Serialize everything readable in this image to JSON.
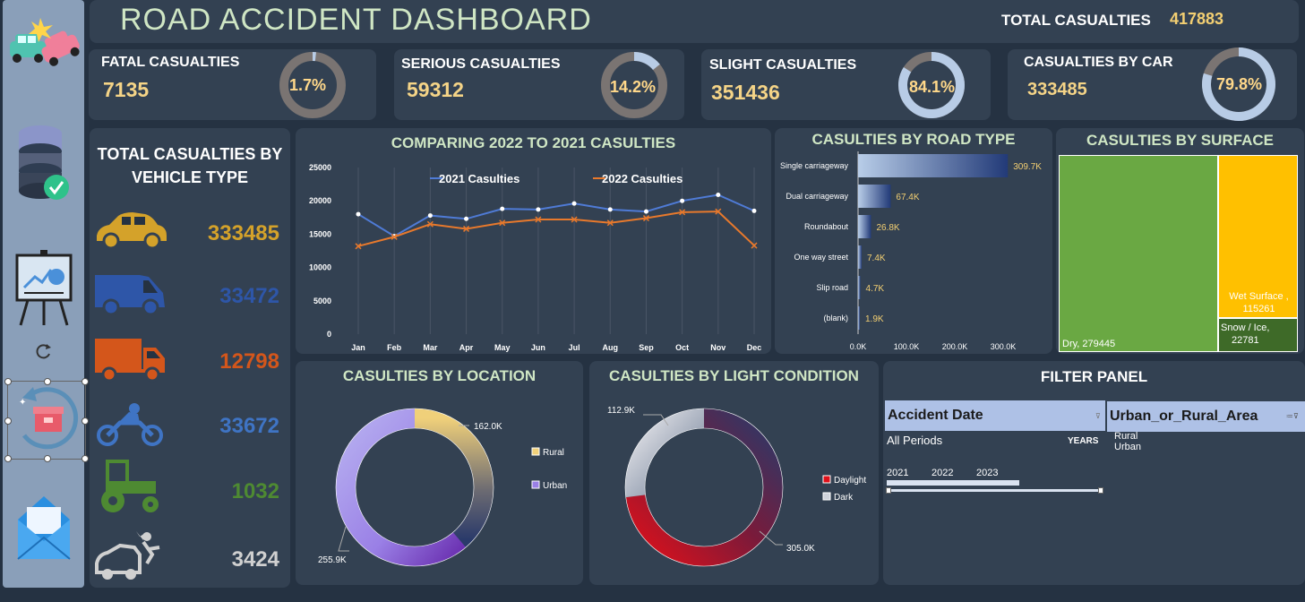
{
  "header": {
    "title": "ROAD ACCIDENT DASHBOARD",
    "total_label": "TOTAL CASUALTIES",
    "total_value": "417883"
  },
  "kpis": [
    {
      "label": "FATAL CASUALTIES",
      "value": "7135",
      "pct_label": "1.7%",
      "pct": 1.7
    },
    {
      "label": "SERIOUS CASUALTIES",
      "value": "59312",
      "pct_label": "14.2%",
      "pct": 14.2
    },
    {
      "label": "SLIGHT CASUALTIES",
      "value": "351436",
      "pct_label": "84.1%",
      "pct": 84.1
    },
    {
      "label": "CASUALTIES BY CAR",
      "value": "333485",
      "pct_label": "79.8%",
      "pct": 79.8
    }
  ],
  "vehicles": {
    "title_line1": "TOTAL CASUALTIES BY",
    "title_line2": "VEHICLE TYPE",
    "items": [
      {
        "icon": "car-icon",
        "value": "333485",
        "color": "#d4a22a"
      },
      {
        "icon": "van-icon",
        "value": "33472",
        "color": "#2e56a8"
      },
      {
        "icon": "truck-icon",
        "value": "12798",
        "color": "#d4561b"
      },
      {
        "icon": "motorcycle-icon",
        "value": "33672",
        "color": "#3f74c4"
      },
      {
        "icon": "tractor-icon",
        "value": "1032",
        "color": "#4e8a32"
      },
      {
        "icon": "crash-icon",
        "value": "3424",
        "color": "#d0d0d0"
      }
    ]
  },
  "line_chart": {
    "title": "COMPARING 2022 TO 2021 CASULTIES",
    "chart_data": {
      "type": "line",
      "categories": [
        "Jan",
        "Feb",
        "Mar",
        "Apr",
        "May",
        "Jun",
        "Jul",
        "Aug",
        "Sep",
        "Oct",
        "Nov",
        "Dec"
      ],
      "ylim": [
        0,
        25000
      ],
      "yticks": [
        "0",
        "5000",
        "10000",
        "15000",
        "20000",
        "25000"
      ],
      "series": [
        {
          "name": "2021 Casulties",
          "color": "#4f7bd6",
          "values": [
            18000,
            14700,
            17800,
            17300,
            18800,
            18700,
            19600,
            18700,
            18400,
            20000,
            20900,
            18500
          ]
        },
        {
          "name": "2022 Casulties",
          "color": "#e8792c",
          "values": [
            13200,
            14600,
            16500,
            15800,
            16700,
            17200,
            17200,
            16700,
            17400,
            18300,
            18400,
            13300
          ]
        }
      ]
    }
  },
  "road_chart": {
    "title": "CASULTIES BY ROAD TYPE",
    "chart_data": {
      "type": "bar",
      "categories": [
        "Single carriageway",
        "Dual carriageway",
        "Roundabout",
        "One way street",
        "Slip road",
        "(blank)"
      ],
      "values": [
        309700,
        67400,
        26800,
        7400,
        4700,
        1900
      ],
      "data_labels": [
        "309.7K",
        "67.4K",
        "26.8K",
        "7.4K",
        "4.7K",
        "1.9K"
      ],
      "xticks": [
        "0.0K",
        "100.0K",
        "200.0K",
        "300.0K"
      ],
      "xlim": [
        0,
        300000
      ]
    }
  },
  "surface_chart": {
    "title": "CASULTIES BY SURFACE",
    "chart_data": {
      "type": "treemap",
      "items": [
        {
          "label": "Dry, 279445",
          "value": 279445,
          "color": "#6aa843"
        },
        {
          "label_line1": "Wet Surface ,",
          "label_line2": "115261",
          "value": 115261,
          "color": "#ffc000"
        },
        {
          "label_line1": "Snow / Ice,",
          "label_line2": "22781",
          "value": 22781,
          "color": "#3e6a28"
        }
      ]
    }
  },
  "location_chart": {
    "title": "CASULTIES BY LOCATION",
    "chart_data": {
      "type": "pie",
      "slices": [
        {
          "name": "Rural",
          "value": 162000,
          "label": "162.0K"
        },
        {
          "name": "Urban",
          "value": 255900,
          "label": "255.9K"
        }
      ]
    },
    "legend": [
      "Rural",
      "Urban"
    ]
  },
  "light_chart": {
    "title": "CASULTIES BY LIGHT CONDITION",
    "chart_data": {
      "type": "pie",
      "slices": [
        {
          "name": "Daylight",
          "value": 305000,
          "label": "305.0K"
        },
        {
          "name": "Dark",
          "value": 112900,
          "label": "112.9K"
        }
      ]
    },
    "legend": [
      "Daylight",
      "Dark"
    ]
  },
  "filter": {
    "title": "FILTER PANEL",
    "date_slicer": {
      "header": "Accident Date",
      "selection": "All Periods",
      "level": "YEARS",
      "years": [
        "2021",
        "2022",
        "2023"
      ]
    },
    "area_slicer": {
      "header": "Urban_or_Rural_Area",
      "items": [
        "Rural",
        "Urban"
      ]
    }
  }
}
